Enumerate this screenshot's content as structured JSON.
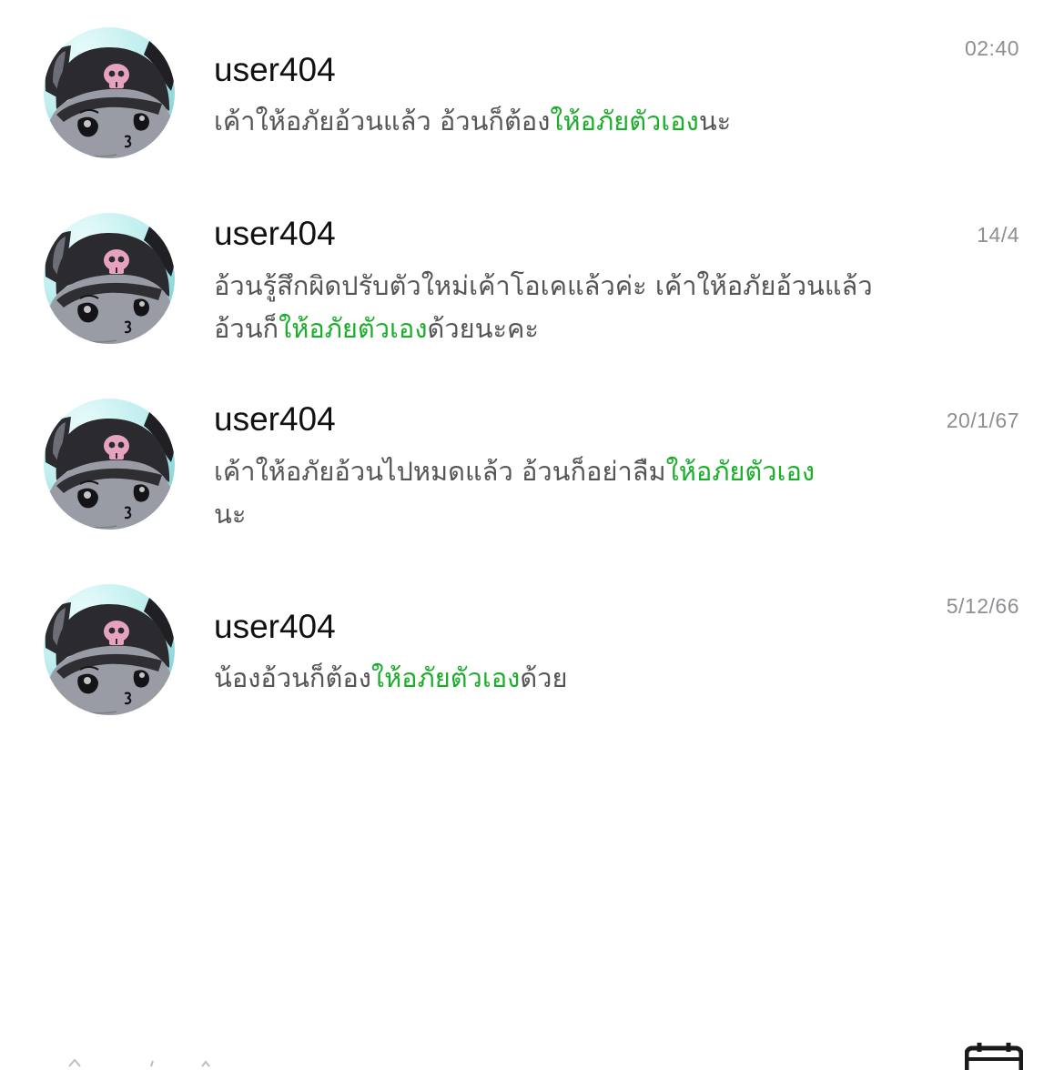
{
  "colors": {
    "highlight": "#1aae2a",
    "message_text": "#555555",
    "name_text": "#111111",
    "time_text": "#8e8e93"
  },
  "chats": [
    {
      "name": "user404",
      "time": "02:40",
      "avatar_icon": "kuromi-avatar-icon",
      "message_before": "เค้าให้อภัยอ้วนแล้ว อ้วนก็ต้อง",
      "message_highlight": "ให้อภัยตัวเอง",
      "message_after": "นะ"
    },
    {
      "name": "user404",
      "time": "14/4",
      "avatar_icon": "kuromi-avatar-icon",
      "message_before": "อ้วนรู้สึกผิดปรับตัวใหม่เค้าโอเคแล้วค่ะ เค้าให้อภัยอ้วนแล้ว อ้วนก็",
      "message_highlight": "ให้อภัยตัวเอง",
      "message_after": "ด้วยนะคะ"
    },
    {
      "name": "user404",
      "time": "20/1/67",
      "avatar_icon": "kuromi-avatar-icon",
      "message_before": "เค้าให้อภัยอ้วนไปหมดแล้ว อ้วนก็อย่าลืม",
      "message_highlight": "ให้อภัยตัวเอง",
      "message_after": "นะ"
    },
    {
      "name": "user404",
      "time": "5/12/66",
      "avatar_icon": "kuromi-avatar-icon",
      "message_before": "น้องอ้วนก็ต้อง",
      "message_highlight": "ให้อภัยตัวเอง",
      "message_after": "ด้วย"
    }
  ],
  "bottom_bar": {
    "right_icon": "calendar-icon"
  }
}
